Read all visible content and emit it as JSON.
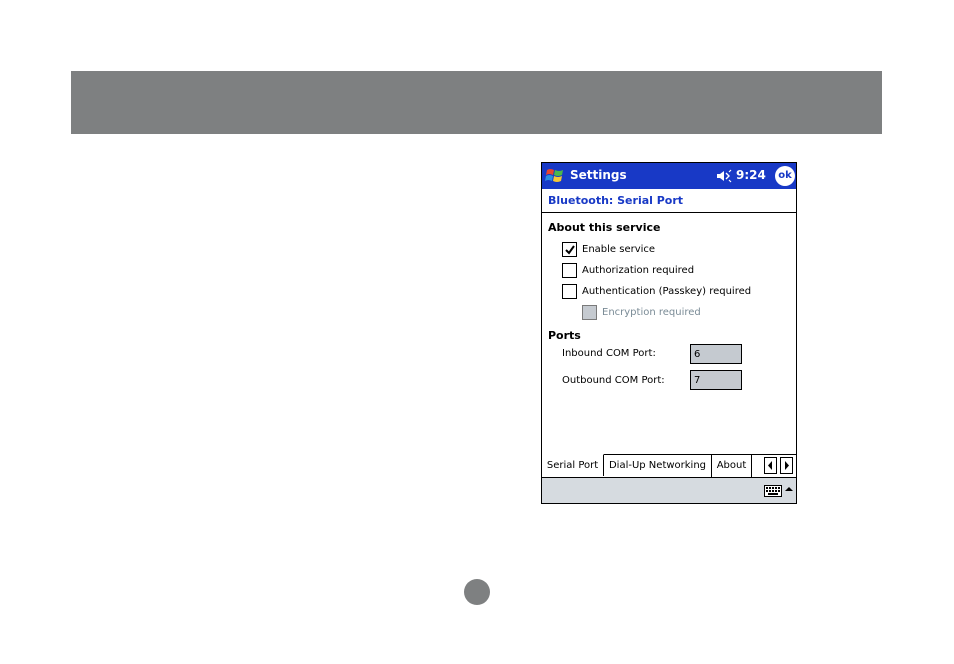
{
  "titlebar": {
    "app_title": "Settings",
    "clock": "9:24",
    "ok_label": "ok"
  },
  "page_header": {
    "title": "Bluetooth: Serial Port"
  },
  "about_section": {
    "title": "About this service",
    "options": [
      {
        "label": "Enable service",
        "checked": true,
        "enabled": true
      },
      {
        "label": "Authorization required",
        "checked": false,
        "enabled": true
      },
      {
        "label": "Authentication (Passkey) required",
        "checked": false,
        "enabled": true
      },
      {
        "label": "Encryption required",
        "checked": false,
        "enabled": false
      }
    ]
  },
  "ports_section": {
    "title": "Ports",
    "inbound_label": "Inbound COM Port:",
    "inbound_value": "6",
    "outbound_label": "Outbound COM Port:",
    "outbound_value": "7"
  },
  "tabs": [
    {
      "label": "Serial Port",
      "active": true
    },
    {
      "label": "Dial-Up Networking",
      "active": false
    },
    {
      "label": "About",
      "active": false
    }
  ],
  "colors": {
    "titlebar": "#1839c6",
    "header_text": "#1839c6",
    "band": "#7e8081"
  },
  "icons": {
    "start": "windows-flag-icon",
    "volume": "speaker-muted-icon",
    "keyboard": "keyboard-icon",
    "tab_left": "arrow-left-icon",
    "tab_right": "arrow-right-icon"
  }
}
